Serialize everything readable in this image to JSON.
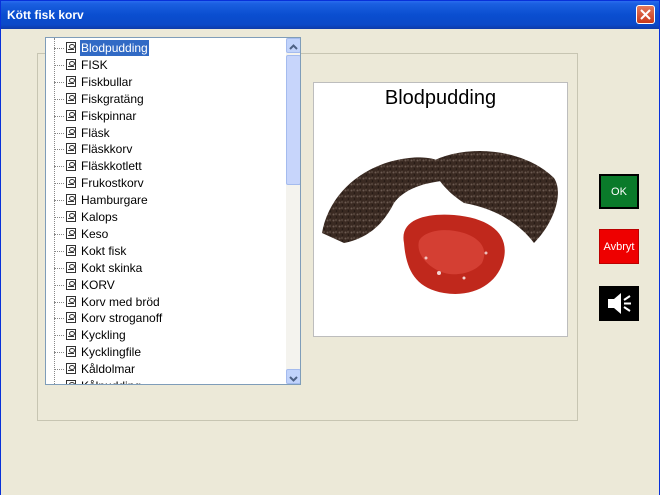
{
  "window": {
    "title": "Kött fisk korv"
  },
  "tree": {
    "selected_index": 0,
    "items": [
      {
        "label": "Blodpudding"
      },
      {
        "label": "FISK"
      },
      {
        "label": "Fiskbullar"
      },
      {
        "label": "Fiskgratäng"
      },
      {
        "label": "Fiskpinnar"
      },
      {
        "label": "Fläsk"
      },
      {
        "label": "Fläskkorv"
      },
      {
        "label": "Fläskkotlett"
      },
      {
        "label": "Frukostkorv"
      },
      {
        "label": "Hamburgare"
      },
      {
        "label": "Kalops"
      },
      {
        "label": "Keso"
      },
      {
        "label": "Kokt fisk"
      },
      {
        "label": "Kokt skinka"
      },
      {
        "label": "KORV"
      },
      {
        "label": "Korv med bröd"
      },
      {
        "label": "Korv stroganoff"
      },
      {
        "label": "Kyckling"
      },
      {
        "label": "Kycklingfile"
      },
      {
        "label": "Kåldolmar"
      },
      {
        "label": "Kålpudding"
      }
    ]
  },
  "preview": {
    "title": "Blodpudding",
    "image": "blood-pudding-photo"
  },
  "buttons": {
    "ok": "OK",
    "cancel": "Avbryt",
    "sound_icon": "speaker-icon"
  },
  "colors": {
    "ok": "#0a7a2a",
    "cancel": "#ee0000",
    "selection": "#316ac5"
  }
}
